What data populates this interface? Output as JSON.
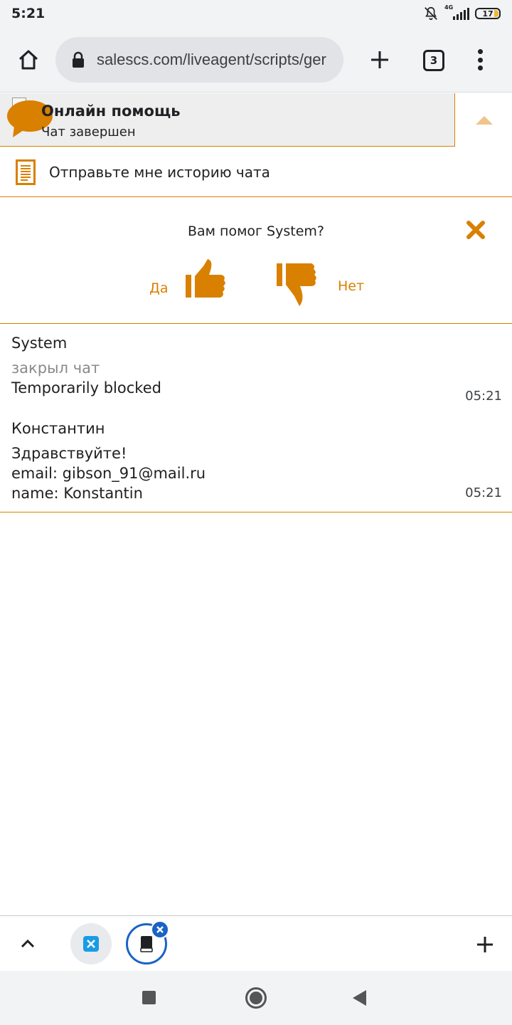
{
  "status_bar": {
    "time": "5:21",
    "network": "4G",
    "battery": "17"
  },
  "browser": {
    "url": "salescs.com/liveagent/scripts/ger",
    "tab_count": "3"
  },
  "chat": {
    "title": "Онлайн помощь",
    "subtitle": "Чат завершен",
    "transcript_label": "Отправьте мне историю чата"
  },
  "feedback": {
    "question": "Вам помог System?",
    "yes": "Да",
    "no": "Нет"
  },
  "messages": [
    {
      "author": "System",
      "note": "закрыл чат",
      "lines": [
        "Temporarily blocked"
      ],
      "time": "05:21"
    },
    {
      "author": "Константин",
      "lines": [
        "Здравствуйте!",
        "email: gibson_91@mail.ru",
        "name: Konstantin"
      ],
      "time": "05:21"
    }
  ],
  "colors": {
    "accent": "#d98000",
    "tab_selected": "#1a63c6"
  }
}
